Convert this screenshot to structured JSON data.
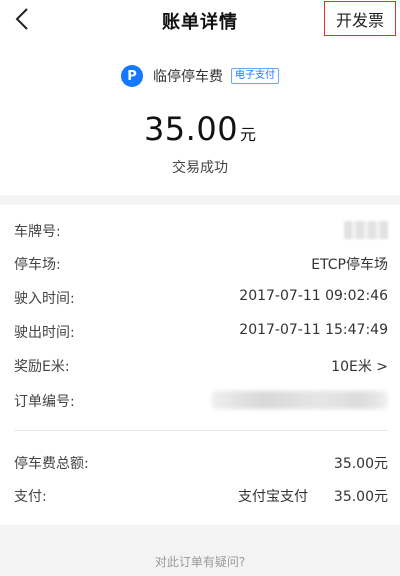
{
  "nav": {
    "title": "账单详情",
    "invoice_label": "开发票"
  },
  "merchant": {
    "icon_letter": "P",
    "name": "临停停车费",
    "tag": "电子支付"
  },
  "amount": {
    "value": "35.00",
    "currency": "元",
    "status": "交易成功"
  },
  "details": [
    {
      "label": "车牌号:",
      "value": ""
    },
    {
      "label": "停车场:",
      "value": "ETCP停车场"
    },
    {
      "label": "驶入时间:",
      "value": "2017-07-11 09:02:46"
    },
    {
      "label": "驶出时间:",
      "value": "2017-07-11 15:47:49"
    },
    {
      "label": "奖励E米:",
      "value": "10E米 >"
    },
    {
      "label": "订单编号:",
      "value": ""
    }
  ],
  "summary": {
    "total_label": "停车费总额:",
    "total_value": "35.00元",
    "pay_label": "支付:",
    "pay_method": "支付宝支付",
    "pay_value": "35.00元"
  },
  "footer": {
    "question": "对此订单有疑问?"
  },
  "colors": {
    "accent": "#1677ff",
    "invoice_border": "#d9342b",
    "band": "#f3f3f3"
  },
  "icons": {
    "back": "chevron-left-icon",
    "parking": "parking-icon"
  }
}
